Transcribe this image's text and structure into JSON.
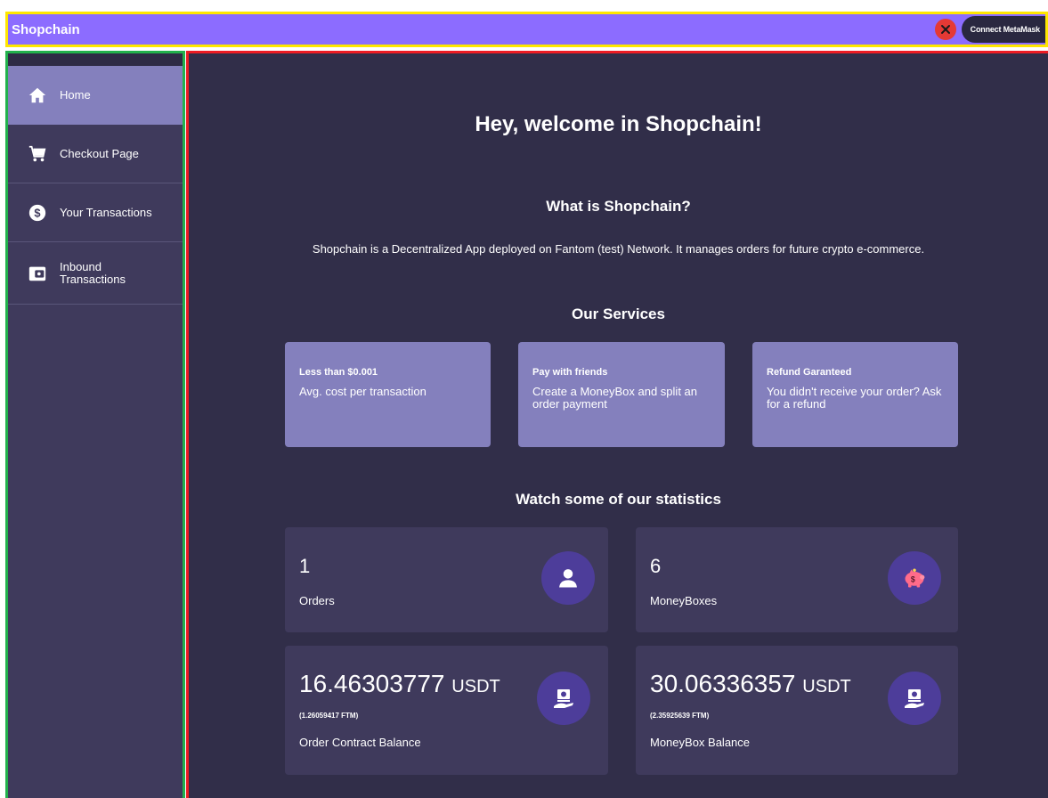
{
  "header": {
    "brand": "Shopchain",
    "connect_label": "Connect MetaMask",
    "close_icon": "close-icon"
  },
  "sidebar": {
    "items": [
      {
        "label": "Home",
        "icon": "home-icon",
        "active": true
      },
      {
        "label": "Checkout Page",
        "icon": "cart-icon",
        "active": false
      },
      {
        "label": "Your Transactions",
        "icon": "dollar-coin-icon",
        "active": false
      },
      {
        "label": "Inbound Transactions",
        "icon": "wallet-icon",
        "active": false
      }
    ]
  },
  "main": {
    "welcome": "Hey, welcome in Shopchain!",
    "what_title": "What is Shopchain?",
    "what_text": "Shopchain is a Decentralized App deployed on Fantom (test) Network. It manages orders for future crypto e-commerce.",
    "services_title": "Our Services",
    "services": [
      {
        "title": "Less than $0.001",
        "desc": "Avg. cost per transaction"
      },
      {
        "title": "Pay with friends",
        "desc": "Create a MoneyBox and split an order payment"
      },
      {
        "title": "Refund Garanteed",
        "desc": "You didn't receive your order? Ask for a refund"
      }
    ],
    "stats_title": "Watch some of our statistics",
    "stats": {
      "orders": {
        "value": "1",
        "label": "Orders",
        "icon": "user-icon"
      },
      "moneyboxes": {
        "value": "6",
        "label": "MoneyBoxes",
        "icon": "piggy-bank-icon"
      },
      "order_balance": {
        "value": "16.46303777",
        "unit": "USDT",
        "sub": "(1.26059417 FTM)",
        "label": "Order Contract Balance",
        "icon": "cash-hand-icon"
      },
      "moneybox_balance": {
        "value": "30.06336357",
        "unit": "USDT",
        "sub": "(2.35925639 FTM)",
        "label": "MoneyBox Balance",
        "icon": "cash-hand-icon"
      }
    }
  },
  "colors": {
    "topbar": "#8c6cff",
    "sidebar": "#3f3a5c",
    "main_bg": "#312e49",
    "card_accent": "#8480bd",
    "icon_circle": "#4d3d9a"
  }
}
